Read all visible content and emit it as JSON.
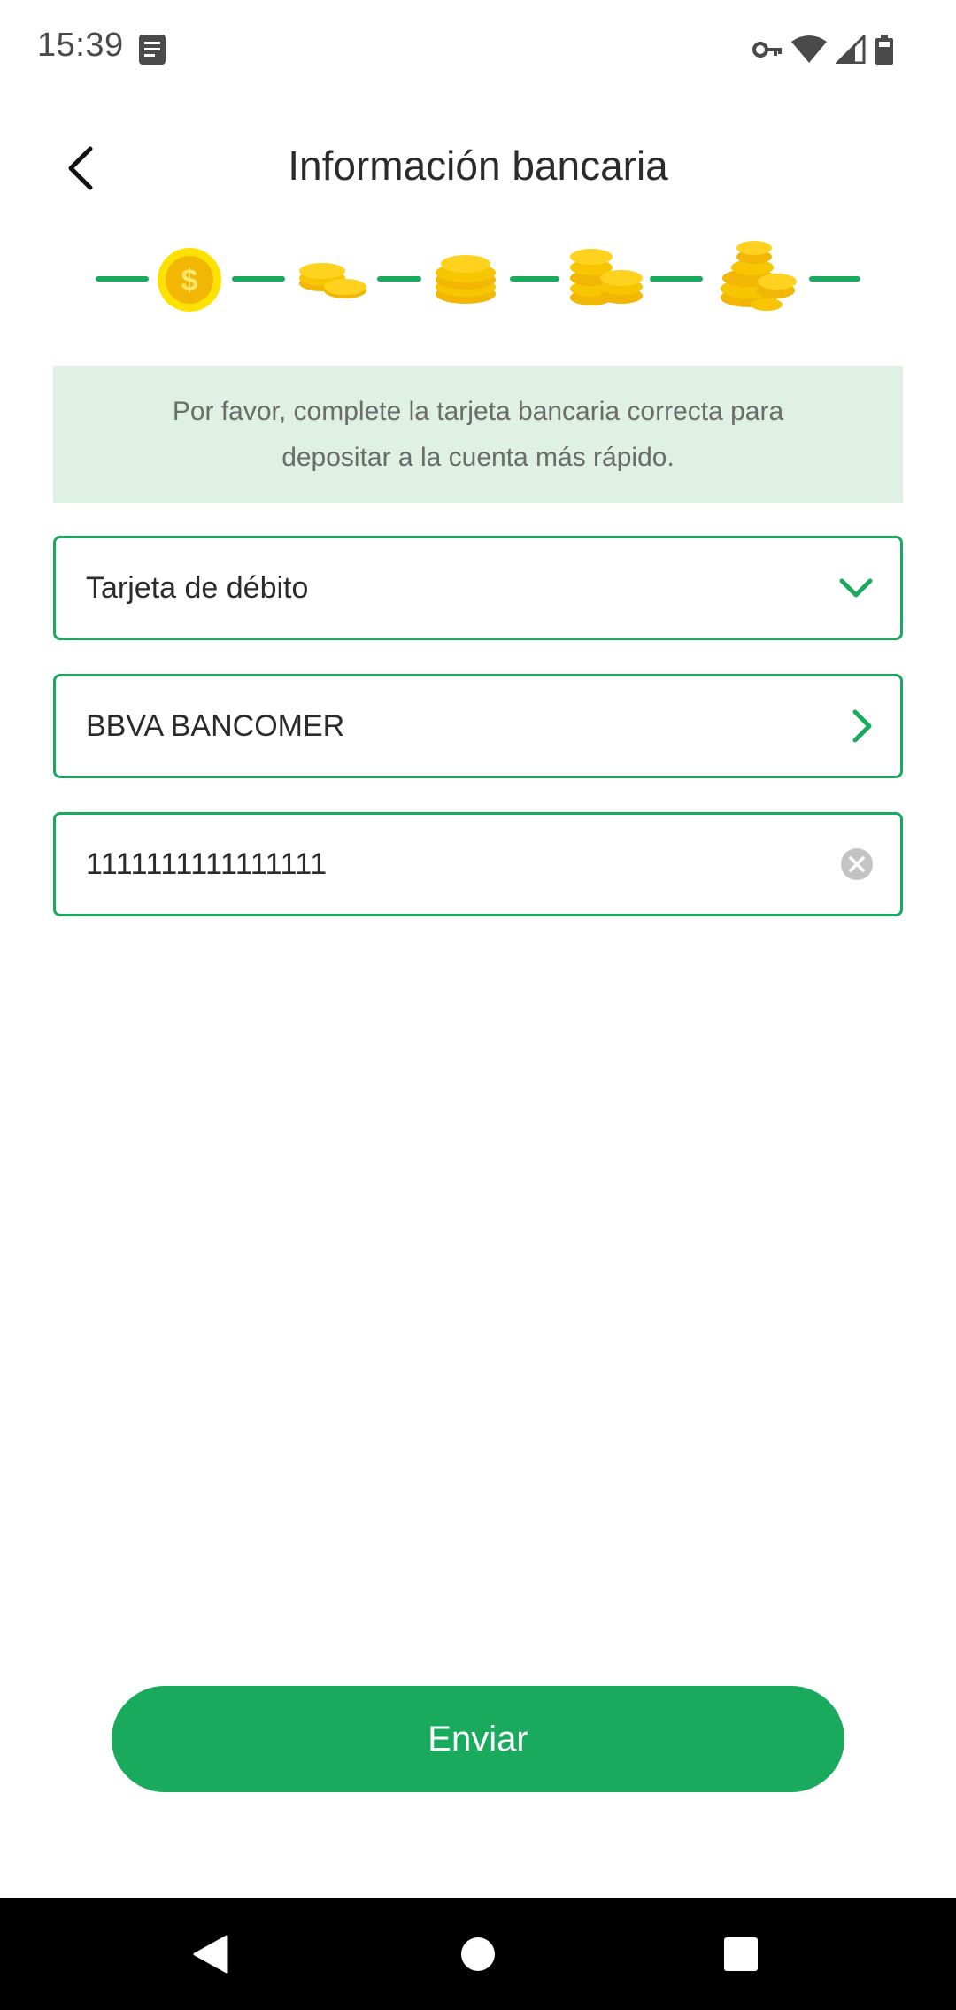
{
  "status_bar": {
    "time": "15:39",
    "icons": [
      "notification-doc-icon",
      "vpn-key-icon",
      "wifi-icon",
      "cell-signal-icon",
      "battery-icon"
    ]
  },
  "header": {
    "title": "Información bancaria",
    "back_icon": "chevron-left-icon"
  },
  "steps": {
    "count": 5,
    "current": 1,
    "icons": [
      "coin-current-icon",
      "coin-stack-2-icon",
      "coin-stack-3-icon",
      "coin-stack-4-icon",
      "coin-stack-5-icon"
    ]
  },
  "notice": {
    "line1": "Por favor, complete la tarjeta bancaria correcta para",
    "line2": "depositar a la cuenta más rápido."
  },
  "form": {
    "card_type": {
      "value": "Tarjeta de débito",
      "icon": "chevron-down-icon"
    },
    "bank": {
      "value": "BBVA BANCOMER",
      "icon": "chevron-right-icon"
    },
    "card_number": {
      "value": "1111111111111111",
      "icon": "clear-icon"
    }
  },
  "submit": {
    "label": "Enviar"
  },
  "colors": {
    "accent": "#1aaa5e",
    "notice_bg": "#dff1e4",
    "coin": "#f7c600"
  },
  "nav_bar": {
    "icons": [
      "back-triangle-icon",
      "home-circle-icon",
      "recents-square-icon"
    ]
  }
}
